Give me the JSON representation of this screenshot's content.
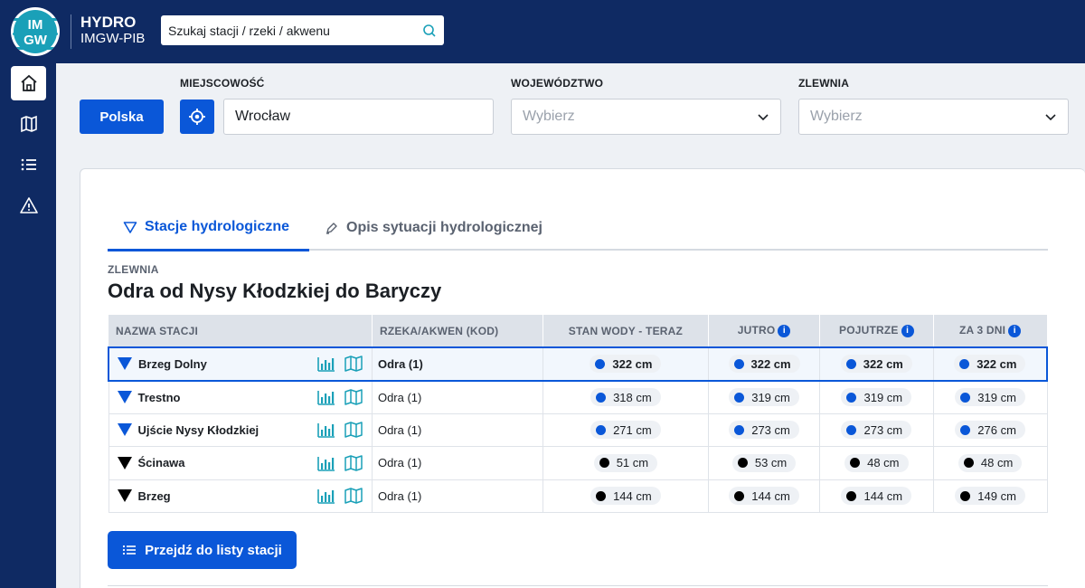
{
  "header": {
    "logo_text_top": "IM",
    "logo_text_bottom": "GW",
    "brand_title": "HYDRO",
    "brand_subtitle": "IMGW-PIB",
    "search_placeholder": "Szukaj stacji / rzeki / akwenu",
    "search_icon": "search-icon"
  },
  "sidebar": {
    "items": [
      {
        "icon": "home-icon",
        "active": true
      },
      {
        "icon": "map-icon",
        "active": false
      },
      {
        "icon": "list-icon",
        "active": false
      },
      {
        "icon": "warning-icon",
        "active": false
      }
    ]
  },
  "filters": {
    "country_button": "Polska",
    "locate_icon": "crosshair-icon",
    "locality_label": "MIEJSCOWOŚĆ",
    "locality_value": "Wrocław",
    "voivodeship_label": "WOJEWÓDZTWO",
    "voivodeship_placeholder": "Wybierz",
    "basin_label": "ZLEWNIA",
    "basin_placeholder": "Wybierz"
  },
  "tabs": [
    {
      "label": "Stacje hydrologiczne",
      "active": true
    },
    {
      "label": "Opis sytuacji hydrologicznej",
      "active": false
    }
  ],
  "basin": {
    "label": "ZLEWNIA",
    "title": "Odra od Nysy Kłodzkiej do Baryczy"
  },
  "table": {
    "headers": {
      "station": "NAZWA STACJI",
      "river": "RZEKA/AKWEN (KOD)",
      "now": "STAN WODY - TERAZ",
      "tomorrow": "JUTRO",
      "day_after": "POJUTRZE",
      "in3": "ZA 3 DNI"
    },
    "rows": [
      {
        "name": "Brzeg Dolny",
        "river": "Odra (1)",
        "now": "322 cm",
        "tomorrow": "322 cm",
        "day_after": "322 cm",
        "in3": "322 cm",
        "marker": "#0a57d8",
        "now_dot": "#0a57d8",
        "dots": [
          "#0a57d8",
          "#0a57d8",
          "#0a57d8"
        ]
      },
      {
        "name": "Trestno",
        "river": "Odra (1)",
        "now": "318 cm",
        "tomorrow": "319 cm",
        "day_after": "319 cm",
        "in3": "319 cm",
        "marker": "#0a57d8",
        "now_dot": "#0a57d8",
        "dots": [
          "#0a57d8",
          "#0a57d8",
          "#0a57d8"
        ]
      },
      {
        "name": "Ujście Nysy Kłodzkiej",
        "river": "Odra (1)",
        "now": "271 cm",
        "tomorrow": "273 cm",
        "day_after": "273 cm",
        "in3": "276 cm",
        "marker": "#0a57d8",
        "now_dot": "#0a57d8",
        "dots": [
          "#0a57d8",
          "#0a57d8",
          "#0a57d8"
        ]
      },
      {
        "name": "Ścinawa",
        "river": "Odra (1)",
        "now": "51 cm",
        "tomorrow": "53 cm",
        "day_after": "48 cm",
        "in3": "48 cm",
        "marker": "#000000",
        "now_dot": "#000000",
        "dots": [
          "#000000",
          "#000000",
          "#000000"
        ]
      },
      {
        "name": "Brzeg",
        "river": "Odra (1)",
        "now": "144 cm",
        "tomorrow": "144 cm",
        "day_after": "144 cm",
        "in3": "149 cm",
        "marker": "#000000",
        "now_dot": "#000000",
        "dots": [
          "#000000",
          "#000000",
          "#000000"
        ]
      }
    ]
  },
  "station_list_button": "Przejdź do listy stacji",
  "colors": {
    "brand_navy": "#0f2a63",
    "accent_blue": "#0a57d8",
    "teal_icon": "#1aa0b8"
  }
}
